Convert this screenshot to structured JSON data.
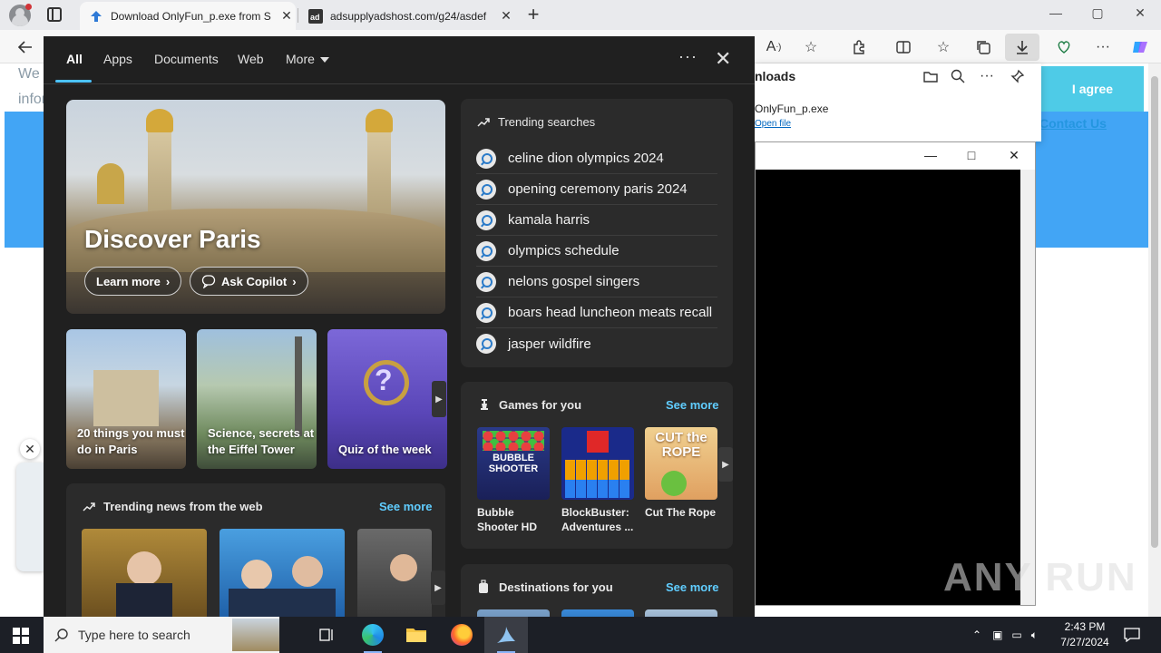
{
  "browser": {
    "tabs": [
      {
        "title": "Download OnlyFun_p.exe from S",
        "active": true
      },
      {
        "title": "adsupplyadshost.com/g24/asdef",
        "active": false
      }
    ],
    "new_tab_label": "+",
    "window_controls": {
      "minimize": "—",
      "maximize": "▢",
      "close": "✕"
    }
  },
  "webpage": {
    "text_line1": "We",
    "text_line2": "infor",
    "agree_label": "I agree",
    "contact_label": "Contact Us"
  },
  "downloads": {
    "title": "nloads",
    "file_name": "OnlyFun_p.exe",
    "open_file": "Open file"
  },
  "app_window": {
    "minimize": "—",
    "maximize": "□",
    "close": "✕"
  },
  "watermark": "ANY RUN",
  "search_panel": {
    "tabs": [
      "All",
      "Apps",
      "Documents",
      "Web",
      "More"
    ],
    "more_menu": "···",
    "close": "✕",
    "hero": {
      "title": "Discover Paris",
      "learn_more": "Learn more",
      "ask_copilot": "Ask Copilot"
    },
    "cards": [
      {
        "caption": "20 things you must do in Paris"
      },
      {
        "caption": "Science, secrets at the Eiffel Tower"
      },
      {
        "caption": "Quiz of the week"
      }
    ],
    "trending": {
      "header": "Trending searches",
      "items": [
        "celine dion olympics 2024",
        "opening ceremony paris 2024",
        "kamala harris",
        "olympics schedule",
        "nelons gospel singers",
        "boars head luncheon meats recall",
        "jasper wildfire"
      ]
    },
    "news": {
      "header": "Trending news from the web",
      "see_more": "See more"
    },
    "games": {
      "header": "Games for you",
      "see_more": "See more",
      "items": [
        {
          "name": "Bubble Shooter HD",
          "thumb_text": "BUBBLE SHOOTER"
        },
        {
          "name": "BlockBuster: Adventures ...",
          "thumb_text": ""
        },
        {
          "name": "Cut The Rope",
          "thumb_text": "CUT the ROPE"
        }
      ]
    },
    "destinations": {
      "header": "Destinations for you",
      "see_more": "See more"
    }
  },
  "taskbar": {
    "search_placeholder": "Type here to search",
    "time": "2:43 PM",
    "date": "7/27/2024"
  },
  "colors": {
    "accent": "#4cc2ff",
    "see_more": "#60cdff",
    "panel_bg": "#202020",
    "card_bg": "#2b2b2b"
  }
}
